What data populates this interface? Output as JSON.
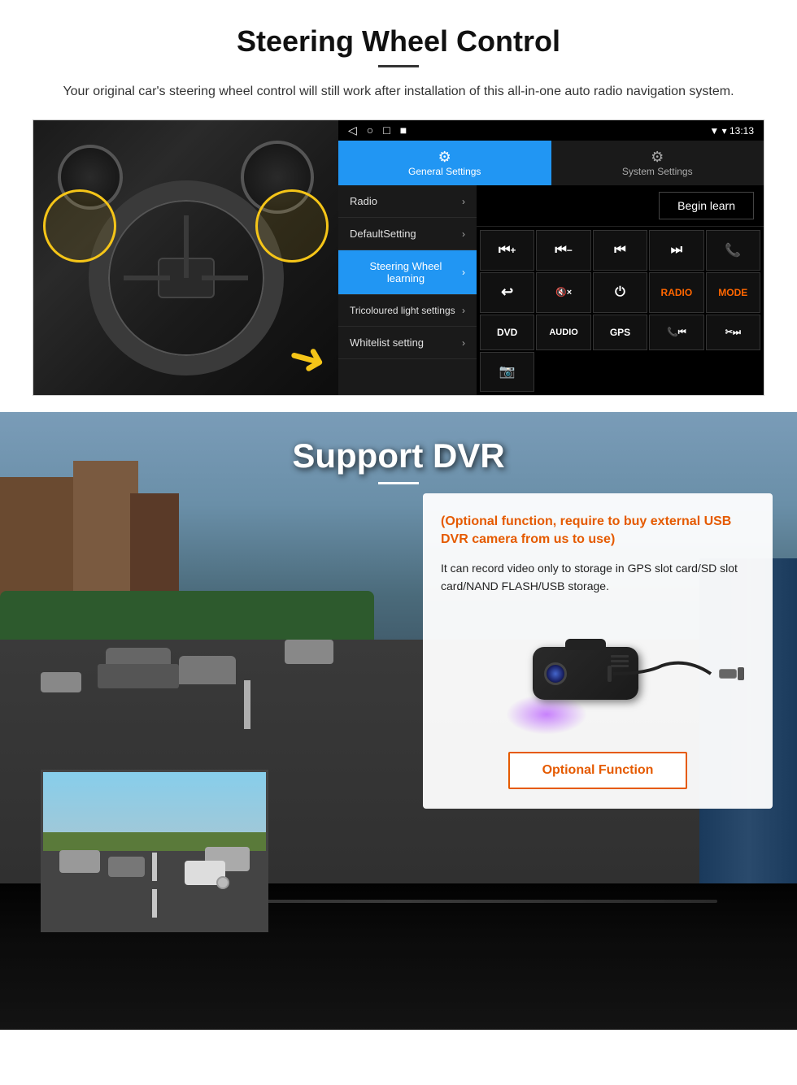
{
  "page": {
    "steering_section": {
      "title": "Steering Wheel Control",
      "subtitle": "Your original car's steering wheel control will still work after installation of this all-in-one auto radio navigation system.",
      "statusbar": {
        "time": "13:13",
        "icons": [
          "◁",
          "○",
          "□",
          "■"
        ]
      },
      "tabs": [
        {
          "label": "General Settings",
          "icon": "⚙",
          "active": true
        },
        {
          "label": "System Settings",
          "icon": "🔧",
          "active": false
        }
      ],
      "menu_items": [
        {
          "label": "Radio",
          "active": false
        },
        {
          "label": "DefaultSetting",
          "active": false
        },
        {
          "label": "Steering Wheel learning",
          "active": true
        },
        {
          "label": "Tricoloured light settings",
          "active": false
        },
        {
          "label": "Whitelist setting",
          "active": false
        }
      ],
      "begin_learn_label": "Begin learn",
      "control_buttons": [
        "⏮+",
        "⏮-",
        "⏮⏮",
        "⏭⏭",
        "📞",
        "↩",
        "🔇×",
        "⏻",
        "RADIO",
        "MODE",
        "DVD",
        "AUDIO",
        "GPS",
        "📞⏮",
        "✂⏭",
        "📷"
      ]
    },
    "dvr_section": {
      "title": "Support DVR",
      "optional_text": "(Optional function, require to buy external USB DVR camera from us to use)",
      "description": "It can record video only to storage in GPS slot card/SD slot card/NAND FLASH/USB storage.",
      "optional_function_label": "Optional Function"
    }
  }
}
